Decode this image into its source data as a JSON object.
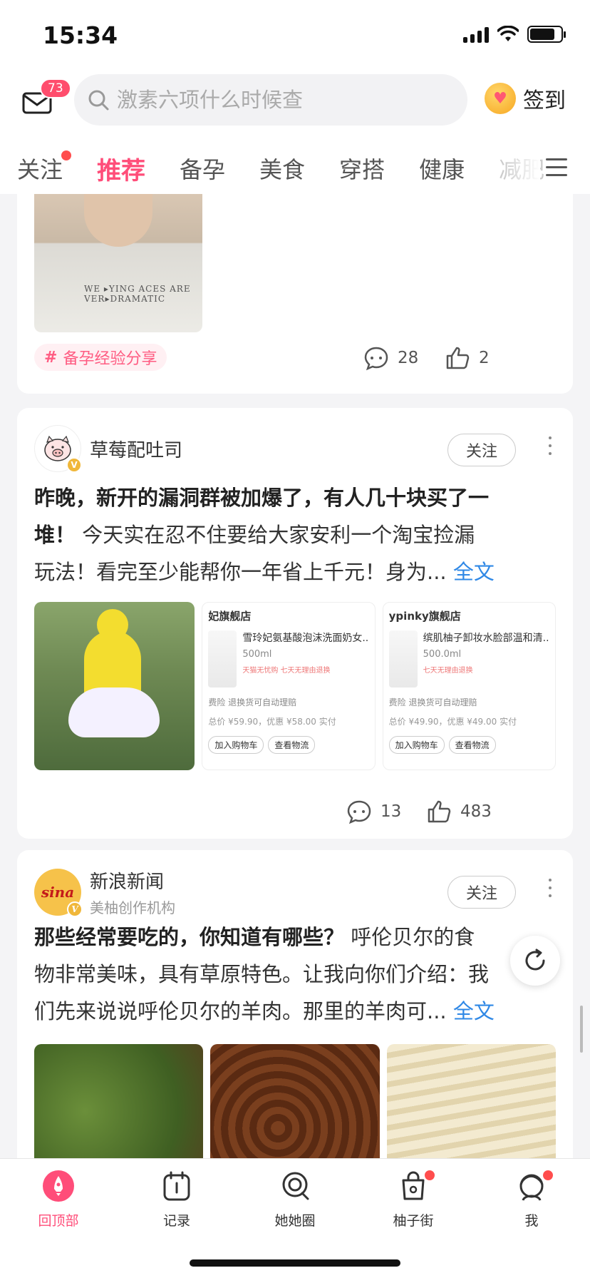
{
  "status": {
    "time": "15:34"
  },
  "header": {
    "mail_badge": "73",
    "search_placeholder": "激素六项什么时候查",
    "sign_label": "签到"
  },
  "tabs": [
    {
      "label": "关注",
      "dot": true
    },
    {
      "label": "推荐",
      "active": true
    },
    {
      "label": "备孕"
    },
    {
      "label": "美食"
    },
    {
      "label": "穿搭"
    },
    {
      "label": "健康"
    },
    {
      "label": "减肥"
    }
  ],
  "cards": {
    "card1": {
      "tag": "备孕经验分享",
      "comments": "28",
      "likes": "2"
    },
    "card2": {
      "author": "草莓配吐司",
      "follow": "关注",
      "title": "昨晚，新开的漏洞群被加爆了，有人几十块买了一堆！",
      "title_line1": "昨晚，新开的漏洞群被加爆了，有人几十块买了一",
      "title_line2": "堆！",
      "body_line2": " 今天实在忍不住要给大家安利一个淘宝捡漏",
      "body_line3": "玩法！看完至少能帮你一年省上千元！身为...",
      "full_text": "全文",
      "shop1": {
        "store": "妃旗舰店",
        "product": "雪玲妃氨基酸泡沫洗面奶女...",
        "spec": "500ml",
        "tags": "天猫无忧购  七天无理由退换",
        "insurance": "费险   退换货可自动理赔",
        "price": "总价 ¥59.90，优惠 ¥58.00 实付",
        "btn1": "加入购物车",
        "btn2": "查看物流"
      },
      "shop2": {
        "store": "ypinky旗舰店",
        "product": "缤肌柚子卸妆水脸部温和清...",
        "spec": "500.0ml",
        "tags": "七天无理由退换",
        "insurance": "费险   退换货可自动理赔",
        "price": "总价 ¥49.90，优惠 ¥49.00 实付",
        "btn1": "加入购物车",
        "btn2": "查看物流"
      },
      "comments": "13",
      "likes": "483"
    },
    "card3": {
      "author": "新浪新闻",
      "author_sub": "美柚创作机构",
      "avatar_text": "sina",
      "follow": "关注",
      "title": "那些经常要吃的，你知道有哪些？",
      "body_line1": " 呼伦贝尔的食",
      "body_line2": "物非常美味，具有草原特色。让我向你们介绍：我",
      "body_line3": "们先来说说呼伦贝尔的羊肉。那里的羊肉可...",
      "full_text": "全文"
    }
  },
  "bottom_nav": [
    {
      "label": "回顶部",
      "active": true
    },
    {
      "label": "记录"
    },
    {
      "label": "她她圈"
    },
    {
      "label": "柚子街",
      "dot": true
    },
    {
      "label": "我",
      "dot": true
    }
  ],
  "colors": {
    "accent": "#ff4d79",
    "link": "#2f88e6",
    "badge": "#ff4d6d"
  }
}
